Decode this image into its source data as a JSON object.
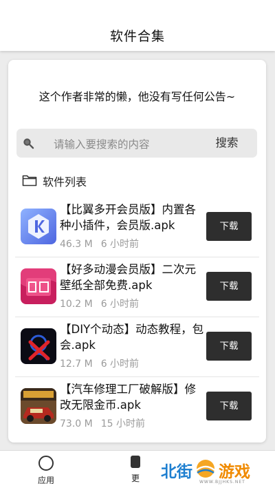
{
  "header": {
    "title": "软件合集"
  },
  "notice": "这个作者非常的懒，他没有写任何公告~",
  "search": {
    "placeholder": "请输入要搜索的内容",
    "button_label": "搜索"
  },
  "list": {
    "header": "软件列表",
    "download_label": "下载",
    "items": [
      {
        "title": "【比翼多开会员版】内置各种小插件，会员版.apk",
        "size": "46.3 M",
        "time": "6 小时前",
        "icon": "k-app-icon"
      },
      {
        "title": "【好多动漫会员版】二次元壁纸全部免费.apk",
        "size": "10.2 M",
        "time": "6 小时前",
        "icon": "anime-app-icon"
      },
      {
        "title": "【DIY个动态】动态教程，包会.apk",
        "size": "12.7 M",
        "time": "6 小时前",
        "icon": "diy-app-icon"
      },
      {
        "title": "【汽车修理工厂破解版】修改无限金币.apk",
        "size": "73.0 M",
        "time": "15 小时前",
        "icon": "car-repair-app-icon"
      }
    ]
  },
  "bottom_nav": {
    "app_label": "应用",
    "more_label": "更"
  },
  "watermark": {
    "left_text": "北街",
    "right_text": "游戏",
    "sub_text": "WWW.BJJHKS.NET"
  },
  "colors": {
    "download_button": "#2e2e2e",
    "watermark_blue": "#1e7fd0",
    "watermark_orange": "#f08a00"
  }
}
